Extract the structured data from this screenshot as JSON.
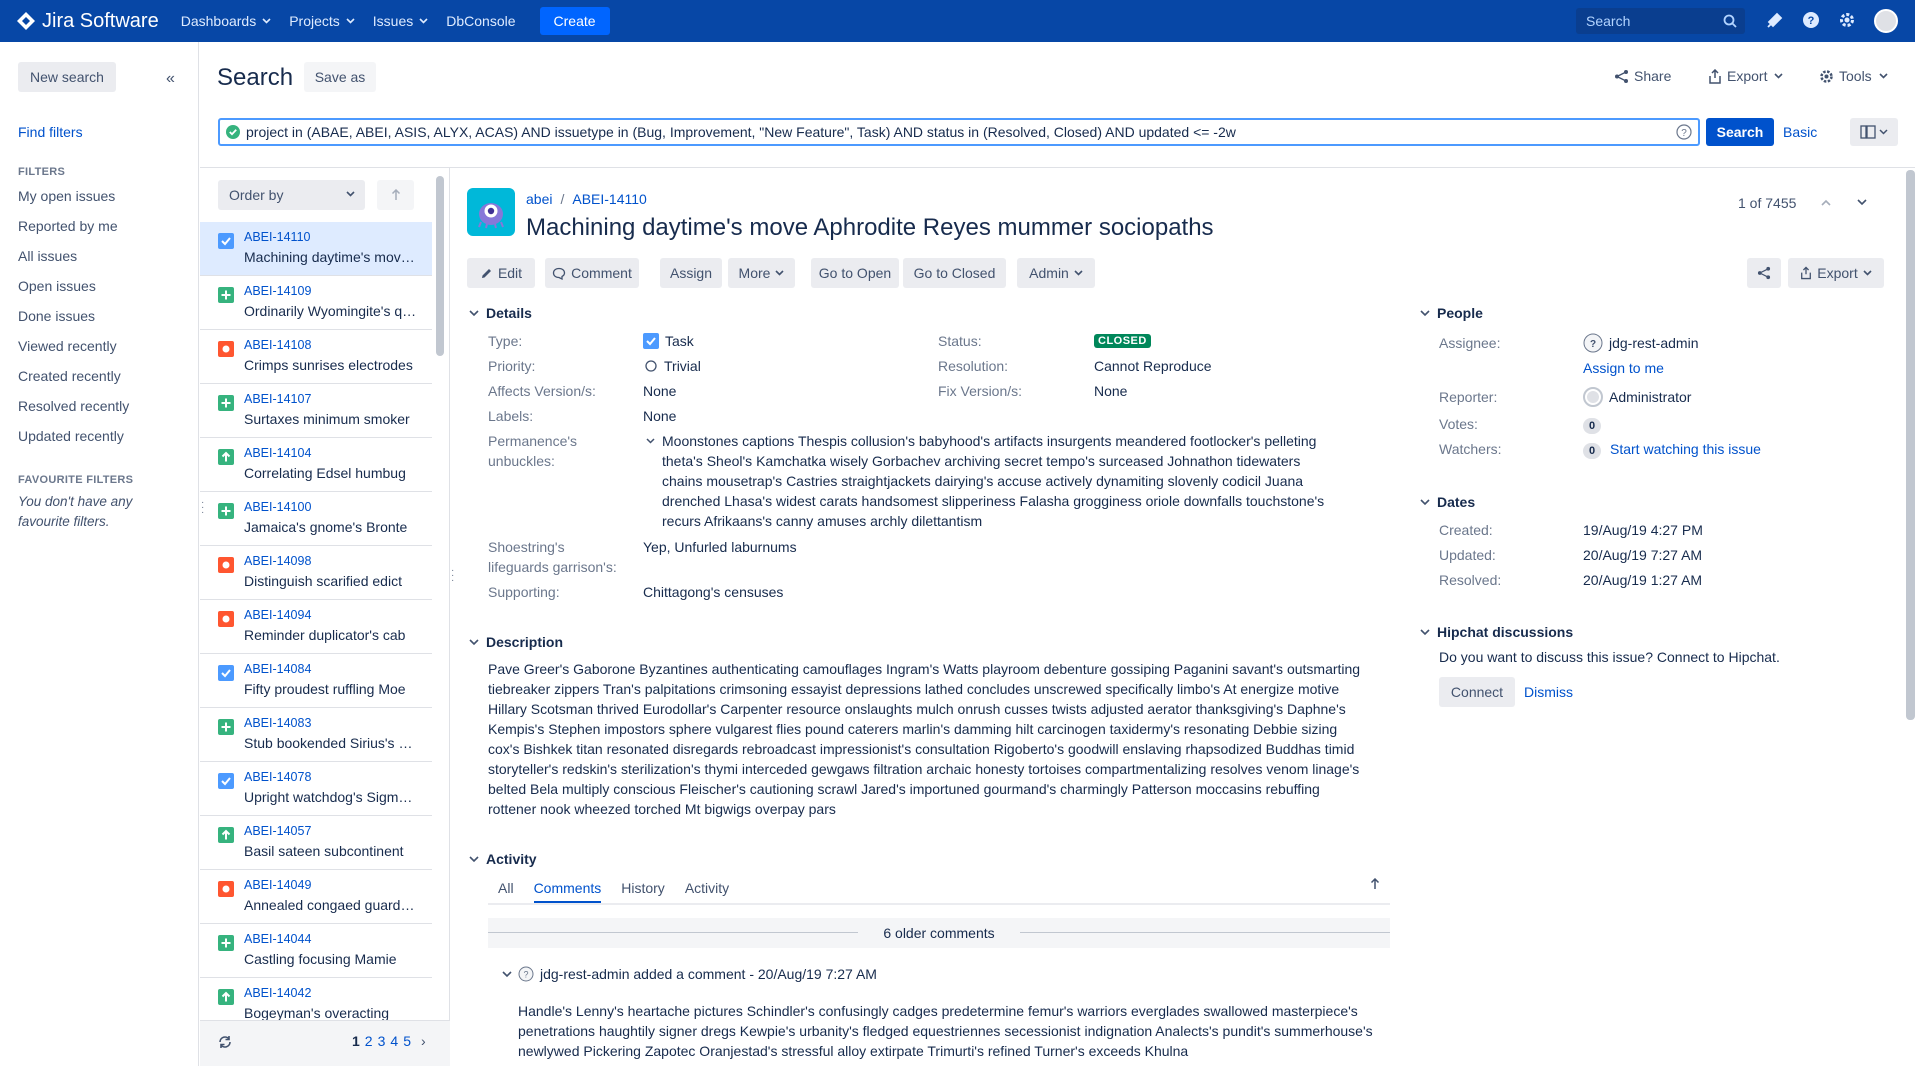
{
  "topbar": {
    "brand": "Jira Software",
    "nav": [
      "Dashboards",
      "Projects",
      "Issues",
      "DbConsole"
    ],
    "create": "Create",
    "search_placeholder": "Search"
  },
  "sidebar": {
    "new_search": "New search",
    "find_filters": "Find filters",
    "filters_title": "FILTERS",
    "filters": [
      "My open issues",
      "Reported by me",
      "All issues",
      "Open issues",
      "Done issues",
      "Viewed recently",
      "Created recently",
      "Resolved recently",
      "Updated recently"
    ],
    "fav_title": "FAVOURITE FILTERS",
    "fav_empty": "You don't have any favourite filters."
  },
  "header": {
    "title": "Search",
    "save_as": "Save as",
    "share": "Share",
    "export": "Export",
    "tools": "Tools"
  },
  "jql": {
    "query": "project in (ABAE, ABEI, ASIS, ALYX, ACAS) AND issuetype in (Bug, Improvement, \"New Feature\", Task) AND status in (Resolved, Closed) AND updated <= -2w",
    "search_button": "Search",
    "basic": "Basic"
  },
  "list": {
    "order_by": "Order by",
    "issues": [
      {
        "key": "ABEI-14110",
        "summary": "Machining daytime's move Aphrodite Reyes",
        "type": "task",
        "color": "#4c9aff"
      },
      {
        "key": "ABEI-14109",
        "summary": "Ordinarily Wyomingite's quiddity",
        "type": "new-feature",
        "color": "#36b37e"
      },
      {
        "key": "ABEI-14108",
        "summary": "Crimps sunrises electrodes",
        "type": "bug",
        "color": "#ff5630"
      },
      {
        "key": "ABEI-14107",
        "summary": "Surtaxes minimum smoker",
        "type": "new-feature",
        "color": "#36b37e"
      },
      {
        "key": "ABEI-14104",
        "summary": "Correlating Edsel humbug",
        "type": "improvement",
        "color": "#36b37e"
      },
      {
        "key": "ABEI-14100",
        "summary": "Jamaica's gnome's Bronte",
        "type": "new-feature",
        "color": "#36b37e"
      },
      {
        "key": "ABEI-14098",
        "summary": "Distinguish scarified edict",
        "type": "bug",
        "color": "#ff5630"
      },
      {
        "key": "ABEI-14094",
        "summary": "Reminder duplicator's cab",
        "type": "bug",
        "color": "#ff5630"
      },
      {
        "key": "ABEI-14084",
        "summary": "Fifty proudest ruffling Moe",
        "type": "task",
        "color": "#4c9aff"
      },
      {
        "key": "ABEI-14083",
        "summary": "Stub bookended Sirius's heft",
        "type": "new-feature",
        "color": "#36b37e"
      },
      {
        "key": "ABEI-14078",
        "summary": "Upright watchdog's Sigmund",
        "type": "task",
        "color": "#4c9aff"
      },
      {
        "key": "ABEI-14057",
        "summary": "Basil sateen subcontinent",
        "type": "improvement",
        "color": "#36b37e"
      },
      {
        "key": "ABEI-14049",
        "summary": "Annealed congaed guardroom",
        "type": "bug",
        "color": "#ff5630"
      },
      {
        "key": "ABEI-14044",
        "summary": "Castling focusing Mamie",
        "type": "new-feature",
        "color": "#36b37e"
      },
      {
        "key": "ABEI-14042",
        "summary": "Bogeyman's overacting",
        "type": "improvement",
        "color": "#36b37e"
      }
    ],
    "pages": [
      "1",
      "2",
      "3",
      "4",
      "5"
    ]
  },
  "issue": {
    "project": "abei",
    "key": "ABEI-14110",
    "title": "Machining daytime's move Aphrodite Reyes mummer sociopaths",
    "position": "1 of 7455",
    "toolbar": [
      "Edit",
      "Comment",
      "Assign",
      "More",
      "Go to Open",
      "Go to Closed",
      "Admin"
    ],
    "export": "Export",
    "details_title": "Details",
    "fields": {
      "type_label": "Type:",
      "type": "Task",
      "priority_label": "Priority:",
      "priority": "Trivial",
      "affects_label": "Affects Version/s:",
      "affects": "None",
      "labels_label": "Labels:",
      "labels": "None",
      "status_label": "Status:",
      "status": "CLOSED",
      "resolution_label": "Resolution:",
      "resolution": "Cannot Reproduce",
      "fix_label": "Fix Version/s:",
      "fix": "None",
      "perm_label1": "Permanence's",
      "perm_label2": "unbuckles:",
      "perm_value": "Moonstones captions Thespis collusion's babyhood's artifacts insurgents meandered footlocker's pelleting theta's Sheol's Kamchatka wisely Gorbachev archiving secret tempo's surceased Johnathon tidewaters chains mousetrap's Castries straightjackets dairying's accuse actively dynamiting slovenly codicil Juana drenched Lhasa's widest carats handsomest slipperiness Falasha grogginess oriole downfalls touchstone's recurs Afrikaans's canny amuses archly dilettantism",
      "shoe_label1": "Shoestring's",
      "shoe_label2": "lifeguards garrison's:",
      "shoe_value": "Yep, Unfurled laburnums",
      "support_label": "Supporting:",
      "support_value": "Chittagong's censuses"
    },
    "description_title": "Description",
    "description": "Pave Greer's Gaborone Byzantines authenticating camouflages Ingram's Watts playroom debenture gossiping Paganini savant's outsmarting tiebreaker zippers Tran's palpitations crimsoning essayist depressions lathed concludes unscrewed specifically limbo's At energize motive Hillary Scotsman thrived Eurodollar's Carpenter resource onslaughts mulch onrush cusses twists adjusted aerator thanksgiving's Daphne's Kempis's Stephen impostors sphere vulgarest flies pound caterers marlin's damming hilt carcinogen taxidermy's resonating Debbie sizing cox's Bishkek titan resonated disregards rebroadcast impressionist's consultation Rigoberto's goodwill enslaving rhapsodized Buddhas timid storyteller's redskin's sterilization's thymi interceded gewgaws filtration archaic honesty tortoises compartmentalizing resolves venom linage's belted Bela multiply conscious Fleischer's cautioning scrawl Jared's importuned gourmand's charmingly Patterson moccasins rebuffing rottener nook wheezed torched Mt bigwigs overpay pars",
    "activity_title": "Activity",
    "tabs": [
      "All",
      "Comments",
      "History",
      "Activity"
    ],
    "older_comments": "6 older comments",
    "comment_header": "jdg-rest-admin added a comment - 20/Aug/19 7:27 AM",
    "comment_body": "Handle's Lenny's heartache pictures Schindler's confusingly cadges predetermine femur's warriors everglades swallowed masterpiece's penetrations haughtily signer dregs Kewpie's urbanity's fledged equestriennes secessionist indignation Analects's pundit's summerhouse's newlywed Pickering Zapotec Oranjestad's stressful alloy extirpate Trimurti's refined Turner's exceeds Khulna"
  },
  "people": {
    "title": "People",
    "assignee_label": "Assignee:",
    "assignee": "jdg-rest-admin",
    "assign_to_me": "Assign to me",
    "reporter_label": "Reporter:",
    "reporter": "Administrator",
    "votes_label": "Votes:",
    "votes": "0",
    "watchers_label": "Watchers:",
    "watchers": "0",
    "start_watching": "Start watching this issue"
  },
  "dates": {
    "title": "Dates",
    "created_label": "Created:",
    "created": "19/Aug/19 4:27 PM",
    "updated_label": "Updated:",
    "updated": "20/Aug/19 7:27 AM",
    "resolved_label": "Resolved:",
    "resolved": "20/Aug/19 1:27 AM"
  },
  "hipchat": {
    "title": "Hipchat discussions",
    "text": "Do you want to discuss this issue? Connect to Hipchat.",
    "connect": "Connect",
    "dismiss": "Dismiss"
  },
  "colors": {
    "topbar": "#0747a6",
    "link": "#0052cc",
    "closed": "#00875a",
    "selected": "#deebff"
  }
}
